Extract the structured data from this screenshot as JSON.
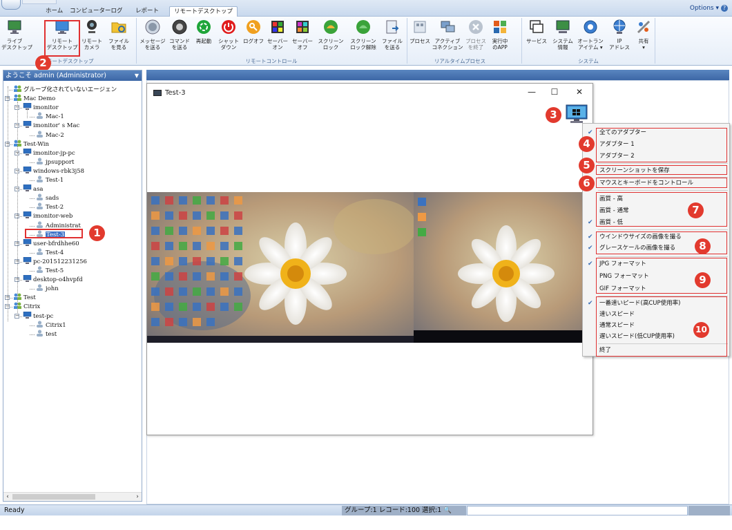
{
  "tabs": [
    {
      "label": "ホーム",
      "active": false
    },
    {
      "label": "コンピューターログ",
      "active": false
    },
    {
      "label": "レポート",
      "active": false
    },
    {
      "label": "リモートデスクトップ",
      "active": true
    }
  ],
  "options_label": "Options",
  "ribbon": {
    "groups": {
      "desktop": "リモートデスクトップ",
      "remote_control": "リモートコントロール",
      "realtime_process": "リアルタイムプロセス",
      "system": "システム"
    },
    "buttons": {
      "live_desktop": "ライブ\nデスクトップ",
      "remote_desktop": "リモート\nデスクトップ",
      "remote_camera": "リモート\nカメラ",
      "files_view": "ファイル\nを見る",
      "send_message": "メッセージ\nを送る",
      "send_command": "コマンド\nを送る",
      "restart": "再起動",
      "shutdown": "シャット\nダウン",
      "logoff": "ログオフ",
      "server_on": "セーバー\nオン",
      "server_off": "セーバー\nオフ",
      "screen_lock": "スクリーン\nロック",
      "screen_unlock": "スクリーン\nロック解除",
      "send_file": "ファイル\nを送る",
      "process": "プロセス",
      "active_connection": "アクティブ\nコネクション",
      "end_process": "プロセス\nを終了",
      "running_app": "実行中\nのAPP",
      "service": "サービス",
      "system_info": "システム\n情報",
      "autorun": "オートラン\nアイテム ▾",
      "ip_address": "IP\nアドレス",
      "share": "共有\n▾"
    }
  },
  "sidebar": {
    "header": "ようこそ admin (Administrator)",
    "tree": [
      {
        "label": "グループ化されていないエージェン",
        "kind": "group"
      },
      {
        "label": "Mac Demo",
        "kind": "group"
      },
      {
        "label": "imonitor",
        "kind": "pc"
      },
      {
        "label": "Mac-1",
        "kind": "user"
      },
      {
        "label": "imonitor' s Mac",
        "kind": "pc"
      },
      {
        "label": "Mac-2",
        "kind": "user"
      },
      {
        "label": "Test-Win",
        "kind": "group"
      },
      {
        "label": "imonitor-jp-pc",
        "kind": "pc"
      },
      {
        "label": "jpsupport",
        "kind": "user"
      },
      {
        "label": "windows-rbk3j58",
        "kind": "pc"
      },
      {
        "label": "Test-1",
        "kind": "user"
      },
      {
        "label": "asa",
        "kind": "pc"
      },
      {
        "label": "sads",
        "kind": "user"
      },
      {
        "label": "Test-2",
        "kind": "user"
      },
      {
        "label": "imonitor-web",
        "kind": "pc"
      },
      {
        "label": "Administrat",
        "kind": "user"
      },
      {
        "label": "Test-3",
        "kind": "user",
        "selected": true
      },
      {
        "label": "user-bfrdhhe60",
        "kind": "pc"
      },
      {
        "label": "Test-4",
        "kind": "user"
      },
      {
        "label": "pc-201512231256",
        "kind": "pc"
      },
      {
        "label": "Test-5",
        "kind": "user"
      },
      {
        "label": "desktop-o4hvpfd",
        "kind": "pc"
      },
      {
        "label": "john",
        "kind": "user"
      },
      {
        "label": "Test",
        "kind": "group"
      },
      {
        "label": "Citrix",
        "kind": "group"
      },
      {
        "label": "test-pc",
        "kind": "pc"
      },
      {
        "label": "Citrix1",
        "kind": "user"
      },
      {
        "label": "test",
        "kind": "user"
      }
    ]
  },
  "remote_window": {
    "title": "Test-3",
    "minimize": "—",
    "maximize": "☐",
    "close": "✕"
  },
  "context_menu": {
    "adapters": [
      {
        "label": "全てのアダプター",
        "checked": true
      },
      {
        "label": "アダプター 1",
        "checked": false
      },
      {
        "label": "アダプター 2",
        "checked": false
      }
    ],
    "save_screenshot": "スクリーンショットを保存",
    "control_mouse_keyboard": "マウスとキーボードをコントロール",
    "quality": [
      {
        "label": "画質 - 高",
        "checked": false
      },
      {
        "label": "画質 - 通常",
        "checked": false
      },
      {
        "label": "画質 - 低",
        "checked": true
      }
    ],
    "capture": [
      {
        "label": "ウインドウサイズの画像を撮る",
        "checked": true
      },
      {
        "label": "グレースケールの画像を撮る",
        "checked": true
      }
    ],
    "formats": [
      {
        "label": "JPG フォーマット",
        "checked": true
      },
      {
        "label": "PNG フォーマット",
        "checked": false
      },
      {
        "label": "GIF フォーマット",
        "checked": false
      }
    ],
    "speeds": [
      {
        "label": "一番速いピード(高CUP使用率)",
        "checked": true
      },
      {
        "label": "速いスピード",
        "checked": false
      },
      {
        "label": "通常スピード",
        "checked": false
      },
      {
        "label": "遅いスピード(低CUP使用率)",
        "checked": false
      }
    ],
    "exit": "終了"
  },
  "callouts": [
    "1",
    "2",
    "3",
    "4",
    "5",
    "6",
    "7",
    "8",
    "9",
    "10"
  ],
  "status": {
    "text": "Ready",
    "info": "グループ:1 レコード:100 選択:1"
  },
  "colors": {
    "accent_red": "#e23a2e",
    "header_blue": "#3c67a6",
    "selection_blue": "#3f73c7"
  }
}
